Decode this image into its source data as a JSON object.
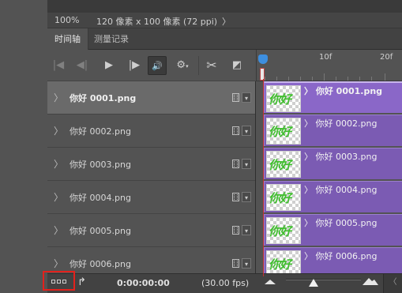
{
  "status_bar": {
    "zoom": "100%",
    "doc_info": "120 像素 x 100 像素 (72 ppi)",
    "arrow": "〉"
  },
  "panel_tabs": [
    {
      "label": "时间轴",
      "active": true
    },
    {
      "label": "测量记录",
      "active": false
    }
  ],
  "toolbar": {
    "first_frame_icon": "|◀",
    "prev_frame_icon": "◀|",
    "play_icon": "▶",
    "next_frame_icon": "|▶",
    "audio_icon": "🔊",
    "settings_icon": "⚙",
    "split_icon": "✂",
    "transition_icon": "◩"
  },
  "ruler": {
    "labels": [
      "10f",
      "20f"
    ]
  },
  "layers": [
    {
      "name": "你好 0001.png",
      "selected": true
    },
    {
      "name": "你好 0002.png",
      "selected": false
    },
    {
      "name": "你好 0003.png",
      "selected": false
    },
    {
      "name": "你好 0004.png",
      "selected": false
    },
    {
      "name": "你好 0005.png",
      "selected": false
    },
    {
      "name": "你好 0006.png",
      "selected": false
    }
  ],
  "clip_thumb_text": "你好",
  "clips": [
    {
      "label": "〉 你好 0001.png"
    },
    {
      "label": "〉 你好 0002.png"
    },
    {
      "label": "〉 你好 0003.png"
    },
    {
      "label": "〉 你好 0004.png"
    },
    {
      "label": "〉 你好 0005.png"
    },
    {
      "label": "〉 你好 0006.png"
    }
  ],
  "bottom_bar": {
    "timecode": "0:00:00:00",
    "fps": "(30.00 fps)",
    "convert_icon": "↱",
    "scroll_left": "〈"
  },
  "colors": {
    "clip_purple": "#7b5bb3",
    "highlight_red": "#e3211c",
    "playhead_blue": "#3d8fe0",
    "thumb_green": "#3ebf2c"
  }
}
